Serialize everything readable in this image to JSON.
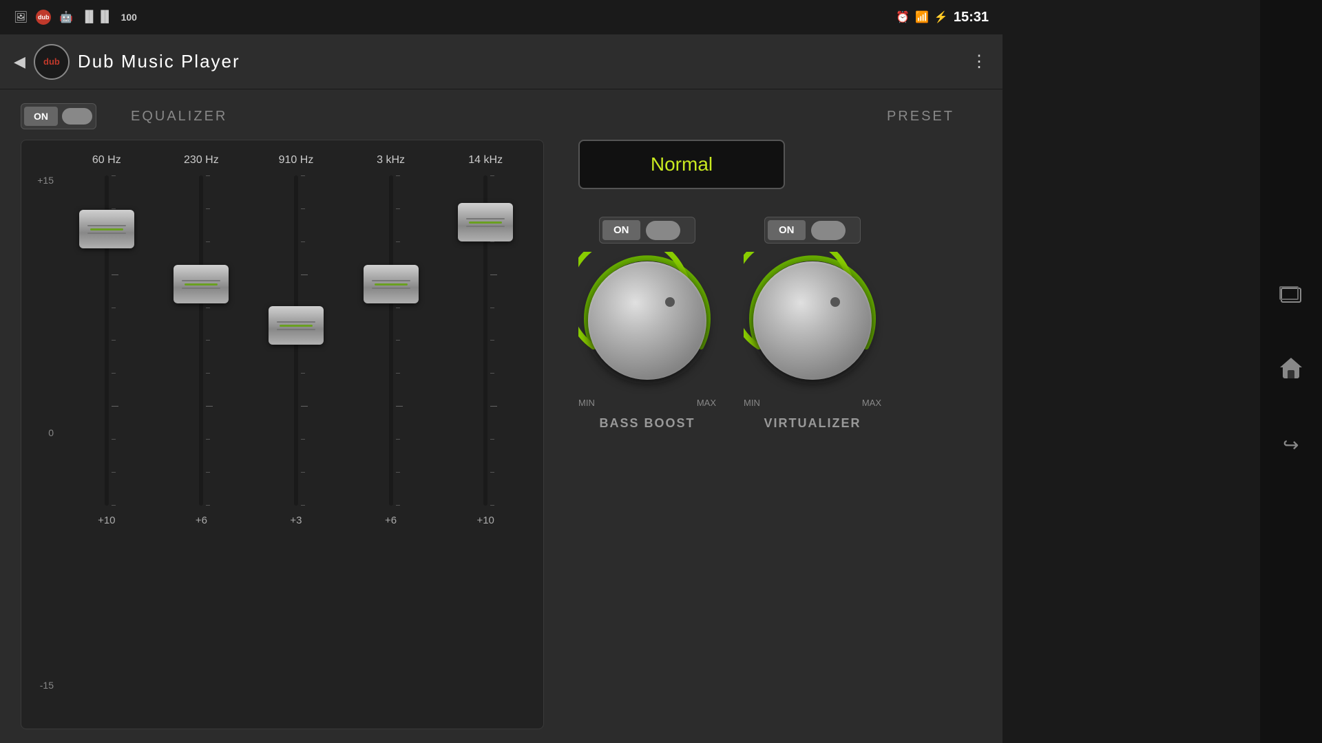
{
  "statusBar": {
    "time": "15:31",
    "icons": [
      "alarm",
      "signal",
      "battery"
    ]
  },
  "appBar": {
    "title": "Dub  Music  Player",
    "logo": "dub",
    "backLabel": "◀",
    "menuLabel": "⋮"
  },
  "equalizer": {
    "onLabel": "ON",
    "label": "EQUALIZER",
    "presetLabel": "PRESET",
    "presetValue": "Normal",
    "bands": [
      {
        "freq": "60 Hz",
        "value": "+10",
        "position": 20
      },
      {
        "freq": "230 Hz",
        "value": "+6",
        "position": 30
      },
      {
        "freq": "910 Hz",
        "value": "+3",
        "position": 40
      },
      {
        "freq": "3 kHz",
        "value": "+6",
        "position": 30
      },
      {
        "freq": "14 kHz",
        "value": "+10",
        "position": 15
      }
    ],
    "yAxis": {
      "top": "+15",
      "mid": "0",
      "bottom": "-15"
    }
  },
  "effects": {
    "bassBoost": {
      "onLabel": "ON",
      "label": "BASS BOOST",
      "minLabel": "MIN",
      "maxLabel": "MAX",
      "knobAngle": 160
    },
    "virtualizer": {
      "onLabel": "ON",
      "label": "VIRTUALIZER",
      "minLabel": "MIN",
      "maxLabel": "MAX",
      "knobAngle": 155
    }
  },
  "navBar": {
    "icons": [
      "rect",
      "home",
      "back"
    ]
  }
}
